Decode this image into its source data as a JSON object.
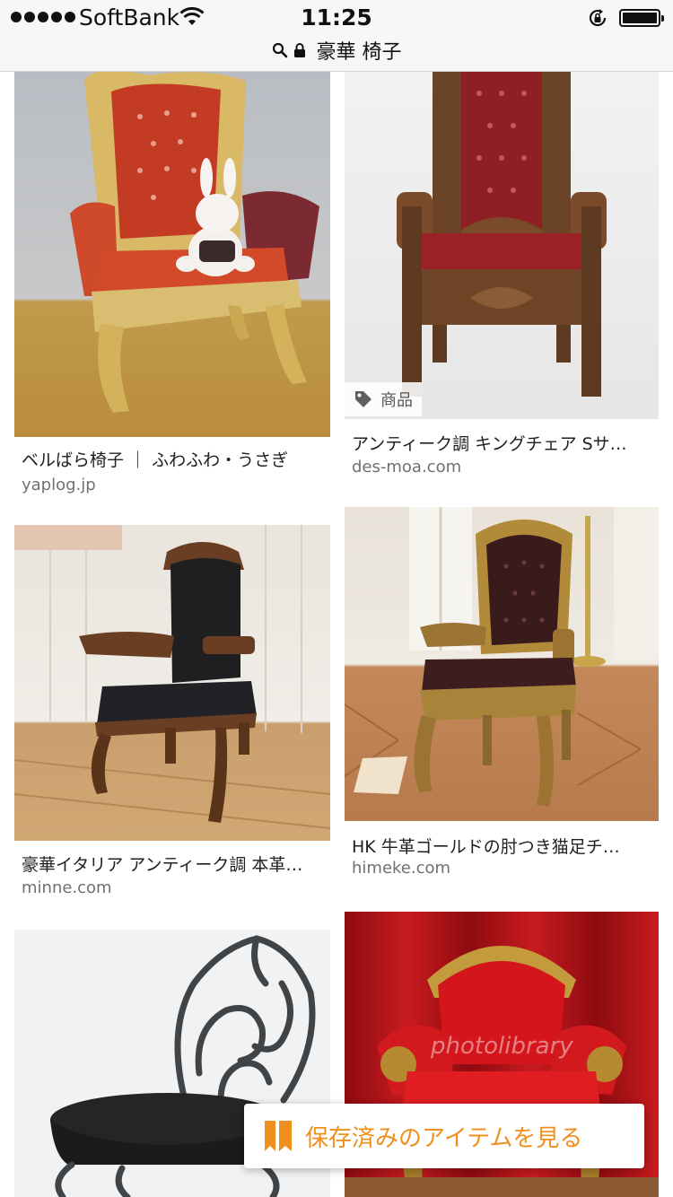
{
  "status_bar": {
    "carrier": "SoftBank",
    "time": "11:25"
  },
  "url_bar": {
    "query": "豪華 椅子"
  },
  "results": [
    {
      "title": "ベルばら椅子 ｜ ふわふわ・うさぎ",
      "domain": "yaplog.jp",
      "tag": null
    },
    {
      "title": "アンティーク調 キングチェア Sサ…",
      "domain": "des-moa.com",
      "tag": "商品"
    },
    {
      "title": "豪華イタリア アンティーク調 本革…",
      "domain": "minne.com",
      "tag": null
    },
    {
      "title": "HK 牛革ゴールドの肘つき猫足チ…",
      "domain": "himeke.com",
      "tag": null
    },
    {
      "title": "",
      "domain": "",
      "tag": null
    },
    {
      "title": "",
      "domain": "",
      "watermark": "photolibrary",
      "tag": null
    }
  ],
  "saved_items": {
    "label": "保存済みのアイテムを見る",
    "accent": "#ef8f1d"
  },
  "icons": {
    "search": "search-icon",
    "lock": "lock-icon",
    "wifi": "wifi-icon",
    "rotation_lock": "rotation-lock-icon",
    "battery": "battery-icon",
    "tag": "tag-icon",
    "bookmark": "bookmark-icon"
  }
}
